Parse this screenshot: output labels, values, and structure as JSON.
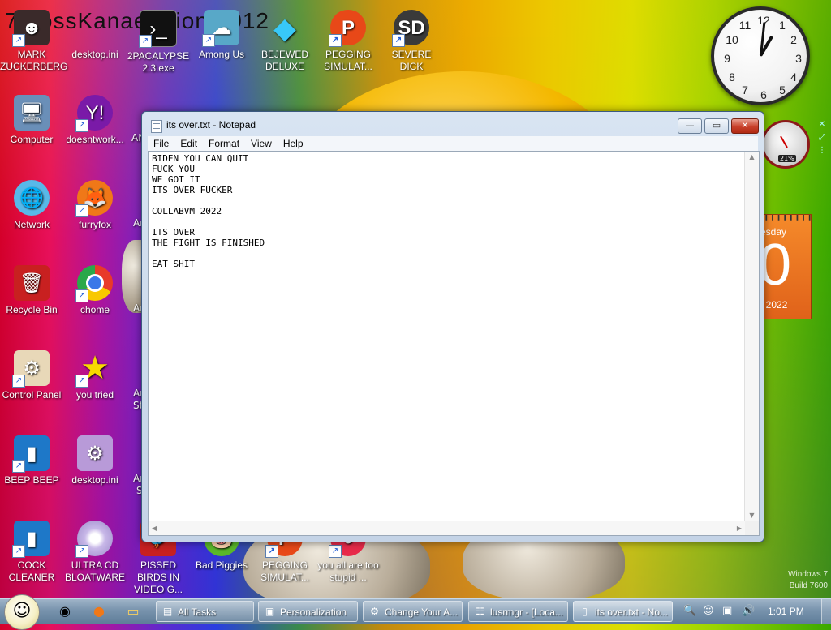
{
  "desktop": {
    "banner": "7...ossKanae...tion 2012",
    "icons": [
      {
        "label": "MARK ZUCKERBERG"
      },
      {
        "label": "desktop.ini"
      },
      {
        "label": "2PACALYPSE 2.3.exe"
      },
      {
        "label": "Among Us"
      },
      {
        "label": "BEJEWED DELUXE"
      },
      {
        "label": "PEGGING SIMULAT..."
      },
      {
        "label": "SEVERE DICK"
      },
      {
        "label": "Computer"
      },
      {
        "label": "doesntwork..."
      },
      {
        "label": "Network"
      },
      {
        "label": "furryfox"
      },
      {
        "label": "Recycle Bin"
      },
      {
        "label": "chome"
      },
      {
        "label": "Control Panel"
      },
      {
        "label": "you tried"
      },
      {
        "label": "BEEP BEEP"
      },
      {
        "label": "desktop.ini"
      },
      {
        "label": "COCK CLEANER"
      },
      {
        "label": "ULTRA CD BLOATWARE"
      },
      {
        "label": "PISSED BIRDS IN VIDEO G..."
      },
      {
        "label": "Bad Piggies"
      },
      {
        "label": "PEGGING SIMULAT..."
      },
      {
        "label": "you all are too stupid ..."
      }
    ],
    "partial_labels": [
      "AN",
      "Ar",
      "Ar",
      "Ar",
      "St",
      "Ar",
      "S"
    ],
    "watermark_line1": "Windows 7",
    "watermark_line2": "Build 7600"
  },
  "notepad": {
    "title": "its over.txt - Notepad",
    "menu": [
      "File",
      "Edit",
      "Format",
      "View",
      "Help"
    ],
    "content": "BIDEN YOU CAN QUIT\nFUCK YOU\nWE GOT IT\nITS OVER FUCKER\n\nCOLLABVM 2022\n\nITS OVER\nTHE FIGHT IS FINISHED\n\nEAT SHIT"
  },
  "gadgets": {
    "clock": {
      "hour": 1,
      "minute": 1
    },
    "cpu_percent": "21%",
    "calendar": {
      "day_text": "esday",
      "big_number": "0",
      "year_text": "t 2022"
    }
  },
  "taskbar": {
    "tasks": [
      {
        "label": "All Tasks"
      },
      {
        "label": "Personalization"
      },
      {
        "label": "Change Your A..."
      },
      {
        "label": "lusrmgr - [Loca..."
      },
      {
        "label": "its over.txt - No..."
      }
    ],
    "time": "1:01 PM"
  }
}
